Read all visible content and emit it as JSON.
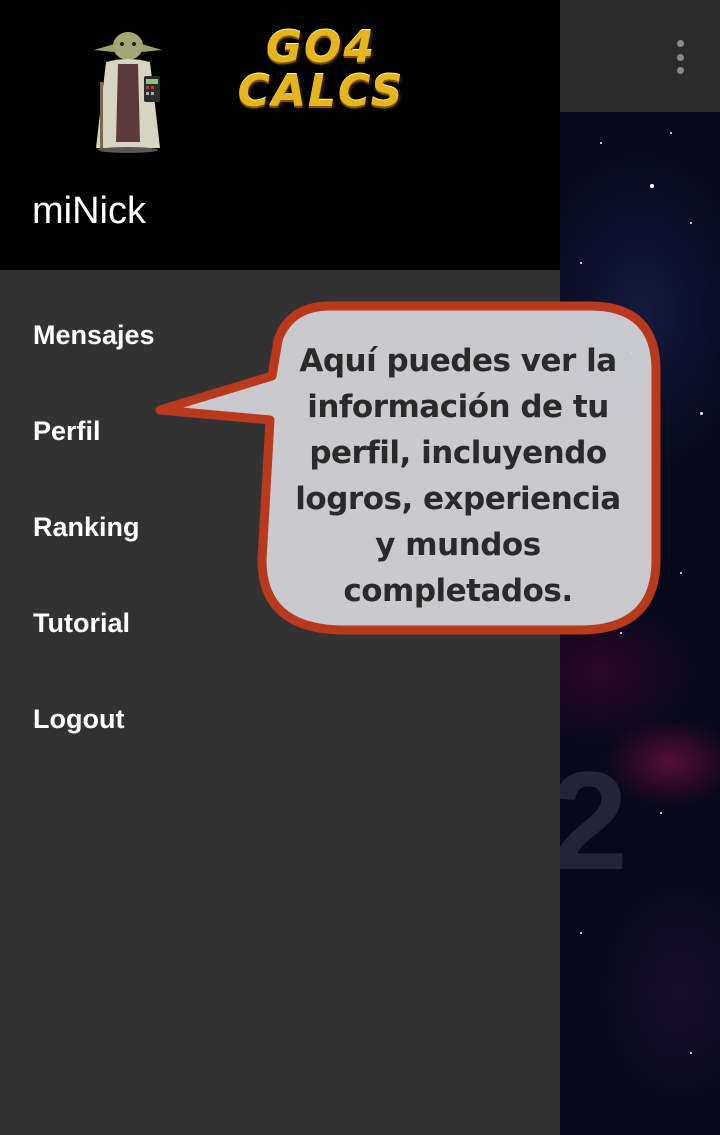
{
  "app": {
    "overflow_icon": "more-vert-icon"
  },
  "drawer": {
    "logo": {
      "line1": "GO4",
      "line2": "CALCS"
    },
    "avatar_icon": "yoda-calculator-icon",
    "user_nick": "miNick",
    "menu": [
      {
        "label": "Mensajes"
      },
      {
        "label": "Perfil"
      },
      {
        "label": "Ranking"
      },
      {
        "label": "Tutorial"
      },
      {
        "label": "Logout"
      }
    ]
  },
  "tooltip": {
    "lines": [
      "Aquí puedes ver la",
      "información de tu",
      "perfil, incluyendo",
      "logros, experiencia",
      "y mundos",
      "completados."
    ]
  },
  "colors": {
    "drawer_bg": "#323232",
    "header_bg": "#000000",
    "bubble_fill": "#d3d3d7",
    "bubble_border": "#b8391c",
    "logo_gold": "#e6b41c"
  }
}
